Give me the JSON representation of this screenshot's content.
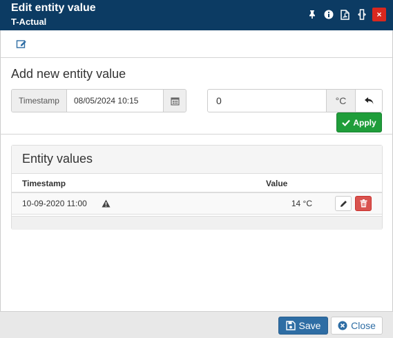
{
  "window": {
    "title": "Edit entity value",
    "subtitle": "T-Actual",
    "icons": [
      "pin-icon",
      "info-icon",
      "pdf-icon",
      "resize-icon",
      "close-icon"
    ],
    "close_label": "×",
    "header_color": "#0c3b63"
  },
  "toolbar": {
    "icons": [
      "edit-icon"
    ]
  },
  "form": {
    "section_title": "Add new entity value",
    "timestamp_label": "Timestamp",
    "timestamp_value": "08/05/2024 10:15",
    "value": "0",
    "unit": "°C",
    "apply_label": "Apply"
  },
  "table": {
    "title": "Entity values",
    "headers": {
      "timestamp": "Timestamp",
      "value": "Value"
    },
    "rows": [
      {
        "timestamp": "10-09-2020 11:00",
        "value": "14 °C",
        "warning": true
      }
    ]
  },
  "footer": {
    "save_label": "Save",
    "close_label": "Close"
  },
  "colors": {
    "primary": "#2e6da4",
    "success": "#1f9d3a",
    "danger": "#d9534f"
  }
}
